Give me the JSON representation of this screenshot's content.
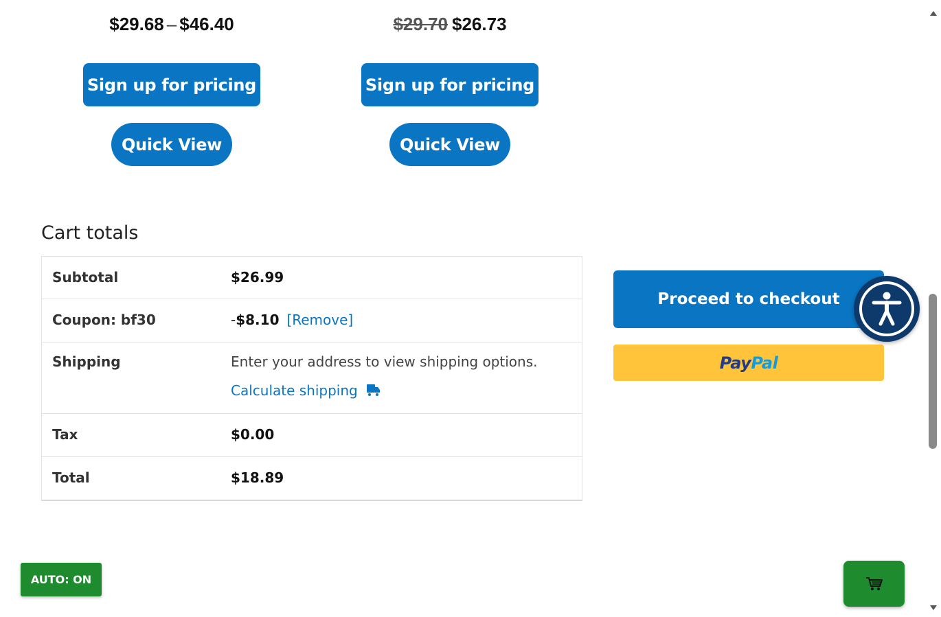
{
  "products": [
    {
      "price_low": "$29.68",
      "price_sep": "–",
      "price_high": "$46.40",
      "signup_label": "Sign up for pricing",
      "quickview_label": "Quick View"
    },
    {
      "price_old": "$29.70",
      "price_new": "$26.73",
      "signup_label": "Sign up for pricing",
      "quickview_label": "Quick View"
    }
  ],
  "cart_totals": {
    "title": "Cart totals",
    "subtotal_label": "Subtotal",
    "subtotal_value": "$26.99",
    "coupon_label": "Coupon: bf30",
    "coupon_minus": "-",
    "coupon_value": "$8.10",
    "coupon_remove": "[Remove]",
    "shipping_label": "Shipping",
    "shipping_text": "Enter your address to view shipping options.",
    "calculate_shipping": "Calculate shipping",
    "tax_label": "Tax",
    "tax_value": "$0.00",
    "total_label": "Total",
    "total_value": "$18.89"
  },
  "checkout": {
    "proceed_label": "Proceed to checkout",
    "paypal_part1": "Pay",
    "paypal_part2": "Pal"
  },
  "widgets": {
    "auto_label": "AUTO: ON",
    "accessibility_icon": "accessibility-icon",
    "cart_icon": "cart-icon"
  },
  "colors": {
    "primary_blue": "#0a75c2",
    "paypal_yellow": "#ffc439",
    "green": "#1e8b2e",
    "accessibility_navy": "#0d3a6b"
  }
}
